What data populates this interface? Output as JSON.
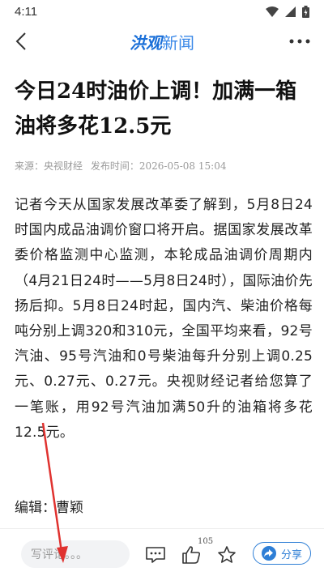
{
  "status_bar": {
    "time": "4:11"
  },
  "nav": {
    "logo_brand": "洪观",
    "logo_rest": "新闻"
  },
  "article": {
    "title": "今日24时油价上调！加满一箱油将多花12.5元",
    "meta_source_label": "来源：",
    "meta_source": "央视财经",
    "meta_time_label": "发布时间：",
    "meta_time": "2026-05-08 15:04",
    "body": "记者今天从国家发展改革委了解到，5月8日24时国内成品油调价窗口将开启。据国家发展改革委价格监测中心监测，本轮成品油调价周期内（4月21日24时——5月8日24时），国际油价先扬后抑。5月8日24时起，国内汽、柴油价格每吨分别上调320和310元，全国平均来看，92号汽油、95号汽油和0号柴油每升分别上调0.25元、0.27元、0.27元。央视财经记者给您算了一笔账，用92号汽油加满50升的油箱将多花12.5元。",
    "editor": "编辑：曹颖"
  },
  "bottom_bar": {
    "comment_placeholder": "写评论。。。",
    "like_count": "105",
    "share_label": "分享"
  },
  "colors": {
    "brand": "#1a6fd8",
    "share": "#2f7fd6",
    "annotation_arrow": "#e0322f"
  },
  "icons": {
    "wifi": "wifi-icon",
    "signal": "signal-icon",
    "battery": "battery-icon",
    "back": "back-arrow-icon",
    "more": "more-dots-icon",
    "comment": "comment-icon",
    "like": "thumbs-up-icon",
    "favorite": "star-icon",
    "share": "share-arrow-icon"
  }
}
